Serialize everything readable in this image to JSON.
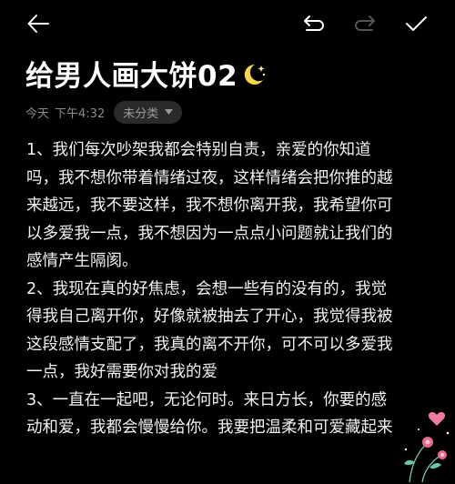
{
  "toolbar": {
    "back_icon": "arrow-left-icon",
    "undo_icon": "undo-icon",
    "redo_icon": "redo-icon",
    "done_icon": "checkmark-icon"
  },
  "note": {
    "title": "给男人画大饼02",
    "title_emoji": "crescent-moon-sparkles",
    "date": "今天",
    "time": "下午4:32",
    "category": "未分类",
    "paragraphs": [
      "1、我们每次吵架我都会特别自责，亲爱的你知道\n吗，我不想你带着情绪过夜，这样情绪会把你推的越\n来越远，我不要这样，我不想你离开我，我希望你可\n以多爱我一点，我不想因为一点点小问题就让我们的\n感情产生隔阂。",
      "2、我现在真的好焦虑，会想一些有的没有的，我觉\n得我自己离开你，好像就被抽去了开心，我觉得我被\n这段感情支配了，我真的离不开你，可不可以多爱我\n一点，我好需要你对我的爱",
      "3、一直在一起吧，无论何时。来日方长，你要的感\n动和爱，我都会慢慢给你。我要把温柔和可爱藏起来"
    ]
  },
  "colors": {
    "background": "#000000",
    "text": "#f2f2f2",
    "meta": "#8a8a8a",
    "chip_bg": "#2a2a2a",
    "redo_disabled": "#555555"
  }
}
